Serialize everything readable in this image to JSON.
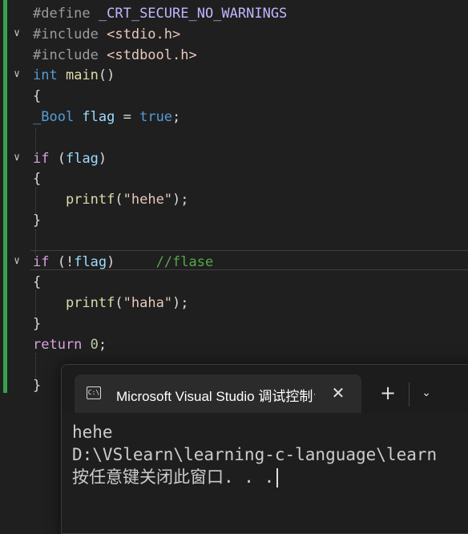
{
  "editor": {
    "lines": [
      {
        "fold": "",
        "tokens": [
          {
            "c": "pp",
            "t": "#define "
          },
          {
            "c": "macro",
            "t": "_CRT_SECURE_NO_WARNINGS"
          }
        ]
      },
      {
        "fold": "v",
        "tokens": [
          {
            "c": "pp",
            "t": "#include "
          },
          {
            "c": "inc",
            "t": "<stdio.h>"
          }
        ]
      },
      {
        "fold": "",
        "tokens": [
          {
            "c": "pp",
            "t": "#include "
          },
          {
            "c": "inc",
            "t": "<stdbool.h>"
          }
        ]
      },
      {
        "fold": "v",
        "tokens": [
          {
            "c": "kw-blue",
            "t": "int "
          },
          {
            "c": "fn",
            "t": "main"
          },
          {
            "c": "plain",
            "t": "()"
          }
        ]
      },
      {
        "fold": "",
        "tokens": [
          {
            "c": "plain",
            "t": "{"
          }
        ]
      },
      {
        "fold": "",
        "tokens": [
          {
            "c": "kw-blue",
            "t": "_Bool "
          },
          {
            "c": "var",
            "t": "flag"
          },
          {
            "c": "plain",
            "t": " = "
          },
          {
            "c": "kw-blue",
            "t": "true"
          },
          {
            "c": "plain",
            "t": ";"
          }
        ]
      },
      {
        "fold": "",
        "tokens": []
      },
      {
        "fold": "v",
        "tokens": [
          {
            "c": "kw-purple",
            "t": "if"
          },
          {
            "c": "plain",
            "t": " ("
          },
          {
            "c": "var",
            "t": "flag"
          },
          {
            "c": "plain",
            "t": ")"
          }
        ]
      },
      {
        "fold": "",
        "tokens": [
          {
            "c": "plain",
            "t": "{"
          }
        ]
      },
      {
        "fold": "",
        "tokens": [
          {
            "c": "plain",
            "t": "    "
          },
          {
            "c": "fn",
            "t": "printf"
          },
          {
            "c": "plain",
            "t": "("
          },
          {
            "c": "str",
            "t": "\"hehe\""
          },
          {
            "c": "plain",
            "t": ");"
          }
        ]
      },
      {
        "fold": "",
        "tokens": [
          {
            "c": "plain",
            "t": "}"
          }
        ]
      },
      {
        "fold": "",
        "tokens": []
      },
      {
        "fold": "v",
        "tokens": [
          {
            "c": "kw-purple",
            "t": "if"
          },
          {
            "c": "plain",
            "t": " (!"
          },
          {
            "c": "var",
            "t": "flag"
          },
          {
            "c": "plain",
            "t": ")     "
          },
          {
            "c": "cmt",
            "t": "//flase"
          }
        ]
      },
      {
        "fold": "",
        "tokens": [
          {
            "c": "plain",
            "t": "{"
          }
        ]
      },
      {
        "fold": "",
        "tokens": [
          {
            "c": "plain",
            "t": "    "
          },
          {
            "c": "fn",
            "t": "printf"
          },
          {
            "c": "plain",
            "t": "("
          },
          {
            "c": "str",
            "t": "\"haha\""
          },
          {
            "c": "plain",
            "t": ");"
          }
        ]
      },
      {
        "fold": "",
        "tokens": [
          {
            "c": "plain",
            "t": "}"
          }
        ]
      },
      {
        "fold": "",
        "tokens": [
          {
            "c": "kw-purple",
            "t": "return"
          },
          {
            "c": "plain",
            "t": " "
          },
          {
            "c": "num",
            "t": "0"
          },
          {
            "c": "plain",
            "t": ";"
          }
        ]
      },
      {
        "fold": "",
        "tokens": []
      },
      {
        "fold": "",
        "tokens": [
          {
            "c": "plain",
            "t": "}"
          }
        ]
      }
    ]
  },
  "terminal": {
    "tab_title": "Microsoft Visual Studio 调试控制台",
    "tab_icon": "C:\\",
    "close_glyph": "✕",
    "new_tab_glyph": "+",
    "dropdown_glyph": "⌄",
    "output_lines": [
      "hehe",
      "D:\\VSlearn\\learning-c-language\\learn",
      "按任意键关闭此窗口. . ."
    ]
  },
  "colors": {
    "editor_bg": "#1f1f1f",
    "gutter_change": "#35a24a",
    "terminal_bg": "#1e1e1e"
  }
}
